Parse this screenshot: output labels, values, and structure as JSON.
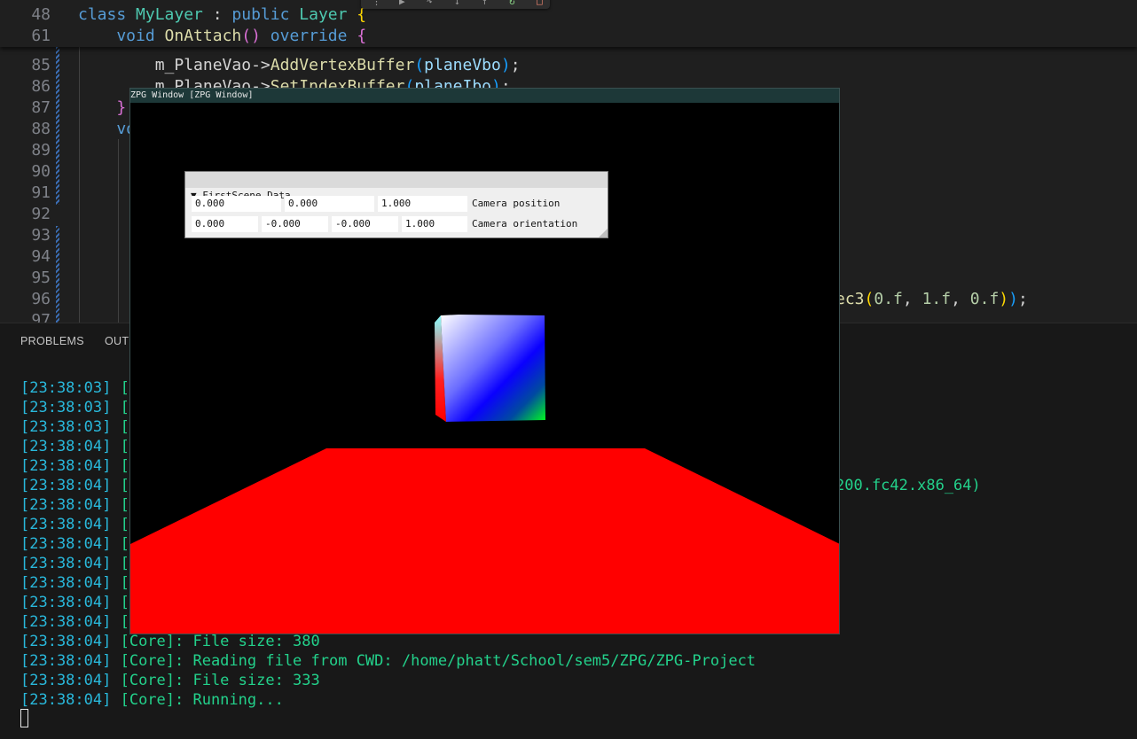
{
  "editor": {
    "sticky_lines": [
      {
        "num": "48",
        "tokens": [
          [
            "kw",
            "class "
          ],
          [
            "ty",
            "MyLayer"
          ],
          [
            "id",
            " : "
          ],
          [
            "kw",
            "public "
          ],
          [
            "ty",
            "Layer "
          ],
          [
            "b1",
            "{"
          ]
        ]
      },
      {
        "num": "61",
        "tokens": [
          [
            "kw",
            "    void "
          ],
          [
            "fn",
            "OnAttach"
          ],
          [
            "b2",
            "()"
          ],
          [
            "kw",
            " override "
          ],
          [
            "b2",
            "{"
          ]
        ]
      }
    ],
    "lines": [
      {
        "num": "85",
        "tokens": [
          [
            "id",
            "        m_PlaneVao->"
          ],
          [
            "fn",
            "AddVertexBuffer"
          ],
          [
            "b3",
            "("
          ],
          [
            "pv",
            "planeVbo"
          ],
          [
            "b3",
            ")"
          ],
          [
            "id",
            ";"
          ]
        ]
      },
      {
        "num": "86",
        "tokens": [
          [
            "id",
            "        m_PlaneVao->"
          ],
          [
            "fn",
            "SetIndexBuffer"
          ],
          [
            "b3",
            "("
          ],
          [
            "pv",
            "planeIbo"
          ],
          [
            "b3",
            ")"
          ],
          [
            "id",
            ";"
          ]
        ]
      },
      {
        "num": "87",
        "tokens": [
          [
            "b2",
            "    }"
          ]
        ]
      },
      {
        "num": "88",
        "tokens": [
          [
            "kw",
            "    vo"
          ]
        ]
      },
      {
        "num": "89",
        "tokens": []
      },
      {
        "num": "90",
        "tokens": []
      },
      {
        "num": "91",
        "tokens": []
      },
      {
        "num": "92",
        "tokens": []
      },
      {
        "num": "93",
        "tokens": []
      },
      {
        "num": "94",
        "tokens": []
      },
      {
        "num": "95",
        "tokens": []
      },
      {
        "num": "96",
        "tokens": [
          [
            "fn",
            "ec3"
          ],
          [
            "b1",
            "("
          ],
          [
            "nm",
            "0.f"
          ],
          [
            "id",
            ", "
          ],
          [
            "nm",
            "1.f"
          ],
          [
            "id",
            ", "
          ],
          [
            "nm",
            "0.f"
          ],
          [
            "b1",
            ")"
          ],
          [
            "b3",
            ")"
          ],
          [
            "id",
            ";"
          ]
        ]
      },
      {
        "num": "97",
        "tokens": []
      }
    ],
    "toolbar_icons": [
      "drag-handle-icon",
      "continue-icon",
      "step-over-icon",
      "step-into-icon",
      "step-out-icon",
      "restart-icon",
      "stop-icon"
    ]
  },
  "panel": {
    "tabs": [
      "PROBLEMS",
      "OUT"
    ],
    "terminal": [
      {
        "ts": "[23:38:03]",
        "text": " [C"
      },
      {
        "ts": "[23:38:03]",
        "text": " [C"
      },
      {
        "ts": "[23:38:03]",
        "text": " [C"
      },
      {
        "ts": "[23:38:04]",
        "text": " [C"
      },
      {
        "ts": "[23:38:04]",
        "text": " [C"
      },
      {
        "ts": "[23:38:04]",
        "text": " [C",
        "tail": "200.fc42.x86_64)"
      },
      {
        "ts": "[23:38:04]",
        "text": " [C"
      },
      {
        "ts": "[23:38:04]",
        "text": " [C"
      },
      {
        "ts": "[23:38:04]",
        "text": " [C"
      },
      {
        "ts": "[23:38:04]",
        "text": " [C"
      },
      {
        "ts": "[23:38:04]",
        "text": " [C"
      },
      {
        "ts": "[23:38:04]",
        "text": " [C"
      },
      {
        "ts": "[23:38:04]",
        "text": " [C"
      },
      {
        "ts": "[23:38:04]",
        "text": " [Core]: File size: 380"
      },
      {
        "ts": "[23:38:04]",
        "text": " [Core]: Reading file from CWD: /home/phatt/School/sem5/ZPG/ZPG-Project"
      },
      {
        "ts": "[23:38:04]",
        "text": " [Core]: File size: 333"
      },
      {
        "ts": "[23:38:04]",
        "text": " [Core]: Running..."
      }
    ]
  },
  "app_window": {
    "title": "ZPG Window [ZPG Window]",
    "imgui": {
      "header": "▼ FirstScene Data",
      "position": [
        "0.000",
        "0.000",
        "1.000"
      ],
      "position_label": "Camera position",
      "orientation": [
        "0.000",
        "-0.000",
        "-0.000",
        "1.000"
      ],
      "orientation_label": "Camera orientation"
    },
    "colors": {
      "plane": "#ff0000",
      "background": "#000000"
    }
  }
}
